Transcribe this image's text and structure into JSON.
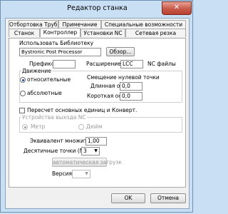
{
  "window": {
    "title": "Редактор станка",
    "close_glyph": "✕"
  },
  "tabs": {
    "row1": [
      "Отбортовка Трубы",
      "Примечание",
      "Специальные возможности"
    ],
    "row2": [
      "Станок",
      "Контроллер",
      "Установки NC",
      "Сетевая резка"
    ],
    "active": "Контроллер"
  },
  "library": {
    "label": "Использовать Библиотеку",
    "value": "Bystronic Post Processor",
    "browse_label": "Обзор..."
  },
  "prefix": {
    "label": "Префикс",
    "value": ""
  },
  "extension": {
    "label": "Расширение",
    "value": "LCC",
    "suffix": "NC файлы"
  },
  "movement": {
    "title": "Движение",
    "options": [
      "относительные",
      "абсолютные"
    ],
    "selected": "относительные"
  },
  "zero_shift": {
    "title": "Смещение нулевой точки",
    "long_axis_label": "Длинная ось",
    "long_axis_value": "0,0",
    "short_axis_label": "Короткая ось",
    "short_axis_value": "0,0"
  },
  "recalc": {
    "label": "Пересчет основных единиц и Конверт.",
    "checked": false
  },
  "output_units": {
    "title": "Устройства выхода NC",
    "options": [
      "Метр",
      "Дюйм"
    ],
    "selected": "Метр"
  },
  "multiplier": {
    "label": "Эквивалент множителя",
    "value": "1,00"
  },
  "decimals": {
    "label": "Десятичные точки (NC",
    "value": "3"
  },
  "autoload": {
    "label": "автоматическая загрузк"
  },
  "version": {
    "label": "Версия",
    "value": ""
  },
  "footer": {
    "ok_label": "OK",
    "cancel_label": "Отмена"
  },
  "colors": {
    "frame": "#c9dff3",
    "close": "#c75a4a",
    "radio_dot": "#1f4fa5"
  }
}
